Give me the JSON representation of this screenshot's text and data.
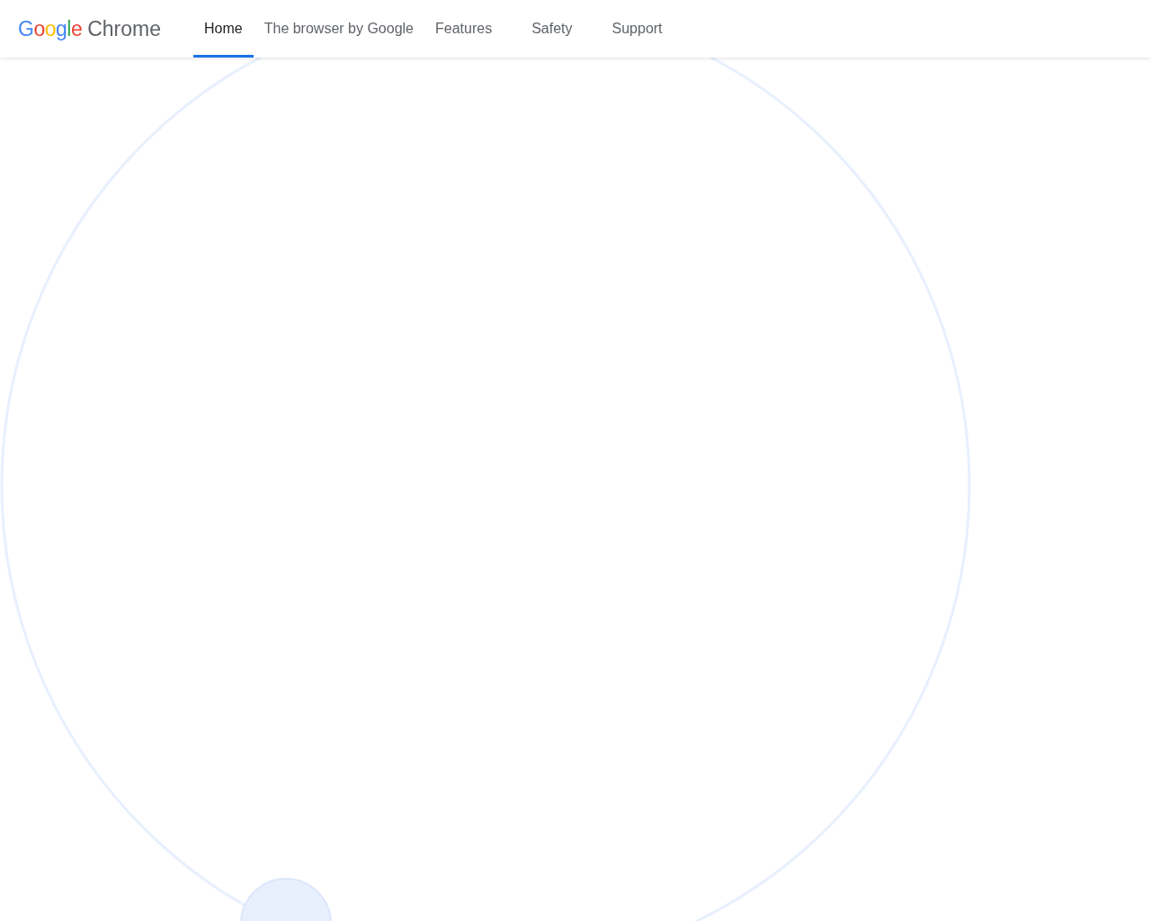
{
  "logo": {
    "letters": [
      {
        "char": "G",
        "color": "#4285f4"
      },
      {
        "char": "o",
        "color": "#ea4335"
      },
      {
        "char": "o",
        "color": "#fbbc05"
      },
      {
        "char": "g",
        "color": "#4285f4"
      },
      {
        "char": "l",
        "color": "#34a853"
      },
      {
        "char": "e",
        "color": "#ea4335"
      }
    ],
    "product": "Chrome"
  },
  "nav": [
    {
      "label": "Home",
      "selected": true
    },
    {
      "label": "The browser by Google",
      "selected": false
    },
    {
      "label": "Features",
      "selected": false
    },
    {
      "label": "Safety",
      "selected": false
    },
    {
      "label": "Support",
      "selected": false
    }
  ]
}
